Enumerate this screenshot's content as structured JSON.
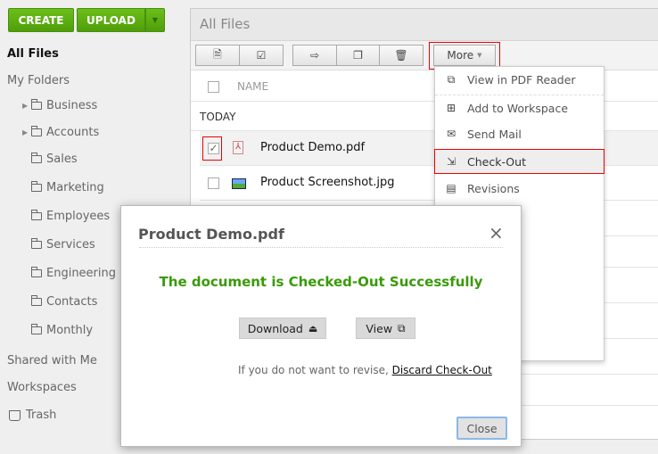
{
  "sidebar": {
    "create": "CREATE",
    "upload": "UPLOAD",
    "all_files": "All Files",
    "my_folders": "My Folders",
    "folders": [
      {
        "label": "Business",
        "expandable": true
      },
      {
        "label": "Accounts",
        "expandable": true
      },
      {
        "label": "Sales"
      },
      {
        "label": "Marketing"
      },
      {
        "label": "Employees"
      },
      {
        "label": "Services"
      },
      {
        "label": "Engineering"
      },
      {
        "label": "Contacts"
      },
      {
        "label": "Monthly"
      }
    ],
    "shared": "Shared with Me",
    "workspaces": "Workspaces",
    "trash": "Trash"
  },
  "main": {
    "title": "All Files",
    "more": "More",
    "name_header": "NAME",
    "group": "TODAY",
    "files": [
      {
        "name": "Product Demo.pdf",
        "checked": true
      },
      {
        "name": "Product Screenshot.jpg",
        "checked": false
      }
    ]
  },
  "menu": {
    "items": [
      "View in PDF Reader",
      "Add to Workspace",
      "Send Mail",
      "Check-Out",
      "Revisions"
    ]
  },
  "modal": {
    "title": "Product Demo.pdf",
    "close_x": "×",
    "message": "The document is Checked-Out Successfully",
    "download": "Download",
    "view": "View",
    "revise_text": "If you do not want to revise,",
    "discard": "Discard Check-Out",
    "close": "Close"
  },
  "colors": {
    "accent": "#4f9e0a",
    "success": "#3a9a0a",
    "highlight": "#e00000"
  }
}
